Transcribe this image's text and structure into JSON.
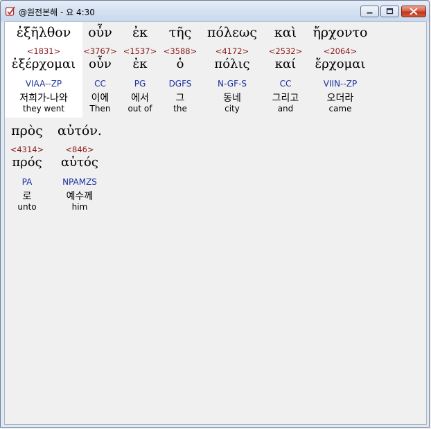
{
  "window": {
    "title": "@원전본해 - 요 4:30",
    "icons": {
      "app": "app-icon",
      "minimize": "minimize-icon",
      "maximize": "maximize-icon",
      "close": "close-icon"
    }
  },
  "verse": {
    "words": [
      {
        "greek": "ἐξῆλθον",
        "strong": "<1831>",
        "lemma": "ἐξέρχομαι",
        "morph": "VIAA--ZP",
        "korean": "저희가-나와",
        "english": "they went",
        "highlighted": true
      },
      {
        "greek": "οὖν",
        "strong": "<3767>",
        "lemma": "οὖν",
        "morph": "CC",
        "korean": "이에",
        "english": "Then",
        "highlighted": false
      },
      {
        "greek": "ἐκ",
        "strong": "<1537>",
        "lemma": "ἐκ",
        "morph": "PG",
        "korean": "에서",
        "english": "out of",
        "highlighted": false
      },
      {
        "greek": "τῆς",
        "strong": "<3588>",
        "lemma": "ὁ",
        "morph": "DGFS",
        "korean": "그",
        "english": "the",
        "highlighted": false
      },
      {
        "greek": "πόλεως",
        "strong": "<4172>",
        "lemma": "πόλις",
        "morph": "N-GF-S",
        "korean": "동네",
        "english": "city",
        "highlighted": false
      },
      {
        "greek": "καὶ",
        "strong": "<2532>",
        "lemma": "καί",
        "morph": "CC",
        "korean": "그리고",
        "english": "and",
        "highlighted": false
      },
      {
        "greek": "ἤρχοντο",
        "strong": "<2064>",
        "lemma": "ἔρχομαι",
        "morph": "VIIN--ZP",
        "korean": "오더라",
        "english": "came",
        "highlighted": false
      },
      {
        "greek": "πρὸς",
        "strong": "<4314>",
        "lemma": "πρός",
        "morph": "PA",
        "korean": "로",
        "english": "unto",
        "highlighted": false
      },
      {
        "greek": "αὐτόν.",
        "strong": "<846>",
        "lemma": "αὐτός",
        "morph": "NPAMZS",
        "korean": "예수께",
        "english": "him",
        "highlighted": false
      }
    ]
  }
}
